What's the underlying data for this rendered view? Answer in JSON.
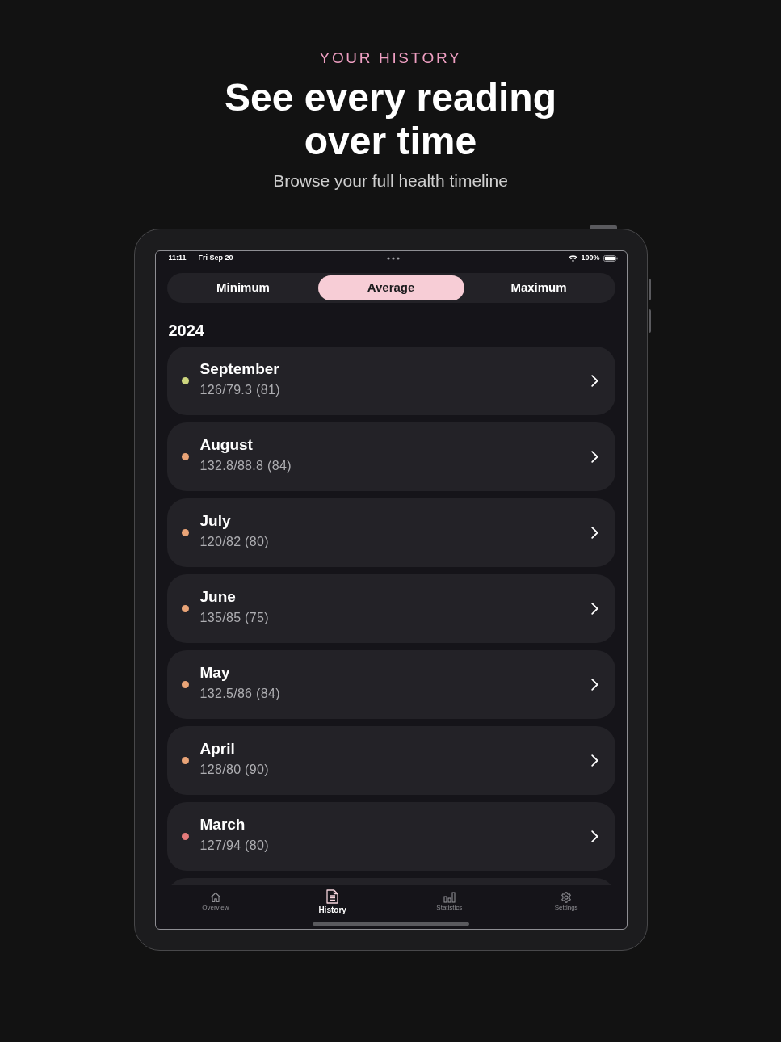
{
  "header": {
    "eyebrow": "YOUR HISTORY",
    "headline": "See **every reading** over time",
    "subtitle": "Browse your full health timeline"
  },
  "status_bar": {
    "time": "11:11",
    "date": "Fri Sep 20",
    "battery": "100%"
  },
  "segments": [
    {
      "label": "Minimum",
      "selected": false
    },
    {
      "label": "Average",
      "selected": true
    },
    {
      "label": "Maximum",
      "selected": false
    }
  ],
  "year": "2024",
  "months": [
    {
      "name": "September",
      "reading": "126/79.3 (81)",
      "color": "#cdd67e"
    },
    {
      "name": "August",
      "reading": "132.8/88.8 (84)",
      "color": "#e9a477"
    },
    {
      "name": "July",
      "reading": "120/82 (80)",
      "color": "#e9a477"
    },
    {
      "name": "June",
      "reading": "135/85 (75)",
      "color": "#e9a477"
    },
    {
      "name": "May",
      "reading": "132.5/86 (84)",
      "color": "#e9a477"
    },
    {
      "name": "April",
      "reading": "128/80 (90)",
      "color": "#e9a477"
    },
    {
      "name": "March",
      "reading": "127/94 (80)",
      "color": "#e57b7b"
    }
  ],
  "tab_bar": [
    {
      "label": "Overview",
      "kind": "home",
      "selected": false
    },
    {
      "label": "History",
      "kind": "document",
      "selected": true
    },
    {
      "label": "Statistics",
      "kind": "chart",
      "selected": false
    },
    {
      "label": "Settings",
      "kind": "gear",
      "selected": false
    }
  ]
}
